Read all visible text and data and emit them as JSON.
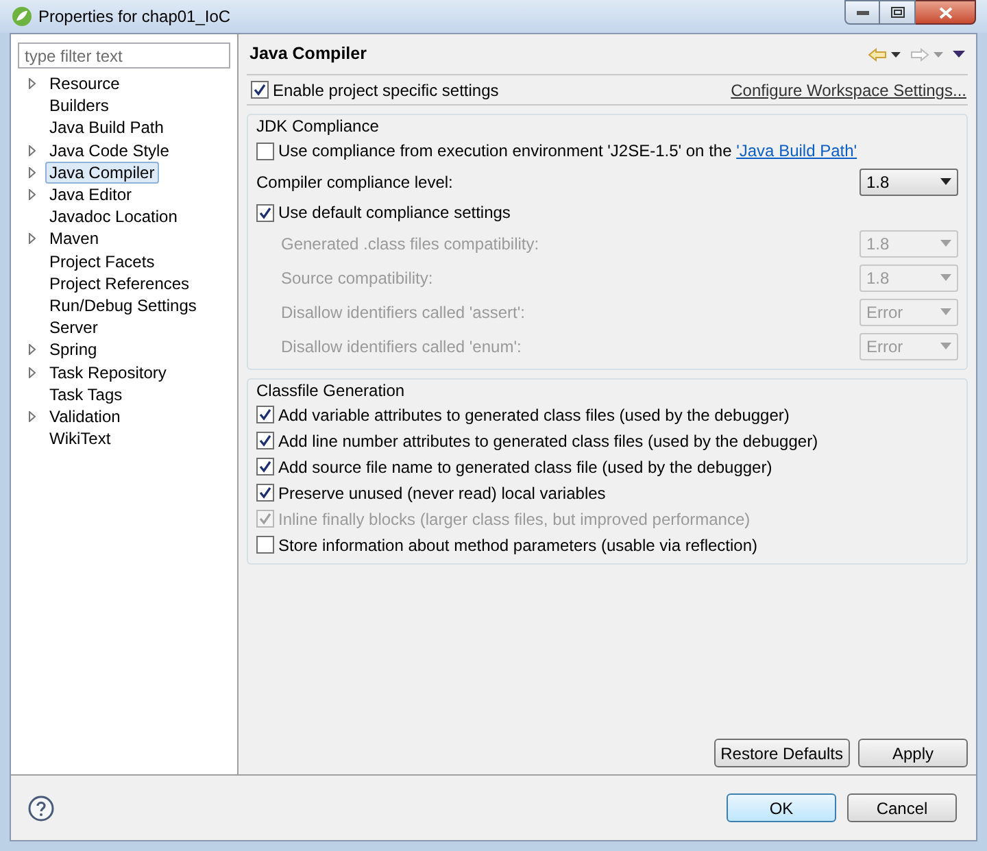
{
  "window": {
    "title": "Properties for chap01_IoC"
  },
  "filter": {
    "placeholder": "type filter text"
  },
  "tree": [
    {
      "label": "Resource",
      "expandable": true,
      "selected": false
    },
    {
      "label": "Builders",
      "expandable": false,
      "selected": false
    },
    {
      "label": "Java Build Path",
      "expandable": false,
      "selected": false
    },
    {
      "label": "Java Code Style",
      "expandable": true,
      "selected": false
    },
    {
      "label": "Java Compiler",
      "expandable": true,
      "selected": true
    },
    {
      "label": "Java Editor",
      "expandable": true,
      "selected": false
    },
    {
      "label": "Javadoc Location",
      "expandable": false,
      "selected": false
    },
    {
      "label": "Maven",
      "expandable": true,
      "selected": false
    },
    {
      "label": "Project Facets",
      "expandable": false,
      "selected": false
    },
    {
      "label": "Project References",
      "expandable": false,
      "selected": false
    },
    {
      "label": "Run/Debug Settings",
      "expandable": false,
      "selected": false
    },
    {
      "label": "Server",
      "expandable": false,
      "selected": false
    },
    {
      "label": "Spring",
      "expandable": true,
      "selected": false
    },
    {
      "label": "Task Repository",
      "expandable": true,
      "selected": false
    },
    {
      "label": "Task Tags",
      "expandable": false,
      "selected": false
    },
    {
      "label": "Validation",
      "expandable": true,
      "selected": false
    },
    {
      "label": "WikiText",
      "expandable": false,
      "selected": false
    }
  ],
  "page": {
    "title": "Java Compiler",
    "enable": {
      "label": "Enable project specific settings",
      "checked": true
    },
    "configure_link": "Configure Workspace Settings...",
    "jdk": {
      "title": "JDK Compliance",
      "use_ee": {
        "label": "Use compliance from execution environment 'J2SE-1.5' on the ",
        "link": "'Java Build Path'",
        "checked": false
      },
      "level": {
        "label": "Compiler compliance level:",
        "value": "1.8"
      },
      "use_default": {
        "label": "Use default compliance settings",
        "checked": true
      },
      "settings": [
        {
          "label": "Generated .class files compatibility:",
          "value": "1.8",
          "disabled": true
        },
        {
          "label": "Source compatibility:",
          "value": "1.8",
          "disabled": true
        },
        {
          "label": "Disallow identifiers called 'assert':",
          "value": "Error",
          "disabled": true
        },
        {
          "label": "Disallow identifiers called 'enum':",
          "value": "Error",
          "disabled": true
        }
      ]
    },
    "classfile": {
      "title": "Classfile Generation",
      "options": [
        {
          "label": "Add variable attributes to generated class files (used by the debugger)",
          "checked": true,
          "disabled": false
        },
        {
          "label": "Add line number attributes to generated class files (used by the debugger)",
          "checked": true,
          "disabled": false
        },
        {
          "label": "Add source file name to generated class file (used by the debugger)",
          "checked": true,
          "disabled": false
        },
        {
          "label": "Preserve unused (never read) local variables",
          "checked": true,
          "disabled": false
        },
        {
          "label": "Inline finally blocks (larger class files, but improved performance)",
          "checked": true,
          "disabled": true
        },
        {
          "label": "Store information about method parameters (usable via reflection)",
          "checked": false,
          "disabled": false
        }
      ]
    },
    "buttons": [
      "Restore Defaults",
      "Apply"
    ]
  },
  "footer_buttons": [
    {
      "label": "OK",
      "default": true
    },
    {
      "label": "Cancel",
      "default": false
    }
  ]
}
